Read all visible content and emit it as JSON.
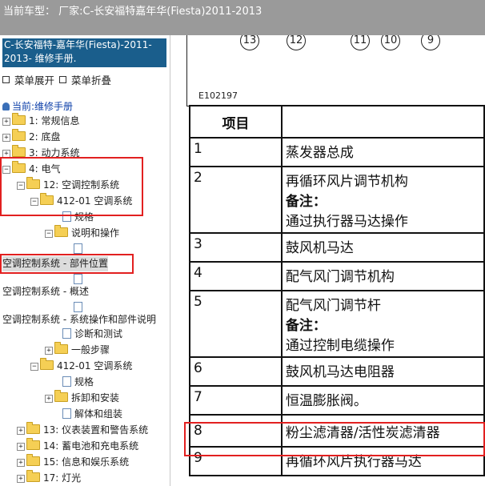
{
  "window": {
    "title": "当前车型：  厂家:C-长安福特嘉年华(Fiesta)2011-2013"
  },
  "sidebar": {
    "header_lines": [
      "C-长安福特-嘉年华(Fiesta)-2011-",
      "2013- 维修手册."
    ],
    "expand_all": "菜单展开",
    "collapse_all": "菜单折叠",
    "current_label": "当前:维修手册",
    "tree": [
      "1: 常规信息",
      "2: 底盘",
      "3: 动力系统",
      "4: 电气",
      "12: 空调控制系统",
      "412-01 空调系统",
      "规格",
      "说明和操作",
      "空调控制系统 - 部件位置",
      "空调控制系统 - 概述",
      "空调控制系统 - 系统操作和部件说明",
      "诊断和测试",
      "一般步骤",
      "412-01 空调系统",
      "规格",
      "拆卸和安装",
      "解体和组装",
      "13: 仪表装置和警告系统",
      "14: 蓄电池和充电系统",
      "15: 信息和娱乐系统",
      "17: 灯光"
    ]
  },
  "diagram": {
    "callouts": [
      "13",
      "12",
      "11",
      "10",
      "9"
    ],
    "figure_id": "E102197"
  },
  "table": {
    "header": [
      "项目",
      ""
    ],
    "note_label": "备注：",
    "rows": [
      {
        "item": "1",
        "desc": "蒸发器总成",
        "note": ""
      },
      {
        "item": "2",
        "desc": "再循环风片调节机构",
        "note": "通过执行器马达操作"
      },
      {
        "item": "3",
        "desc": "鼓风机马达",
        "note": ""
      },
      {
        "item": "4",
        "desc": "配气风门调节机构",
        "note": ""
      },
      {
        "item": "5",
        "desc": "配气风门调节杆",
        "note": "通过控制电缆操作"
      },
      {
        "item": "6",
        "desc": "鼓风机马达电阻器",
        "note": ""
      },
      {
        "item": "7",
        "desc": "恒温膨胀阀。",
        "note": ""
      },
      {
        "item": "8",
        "desc": "粉尘滤清器/活性炭滤清器",
        "note": ""
      },
      {
        "item": "9",
        "desc": "再循环风片执行器马达",
        "note": ""
      }
    ]
  }
}
